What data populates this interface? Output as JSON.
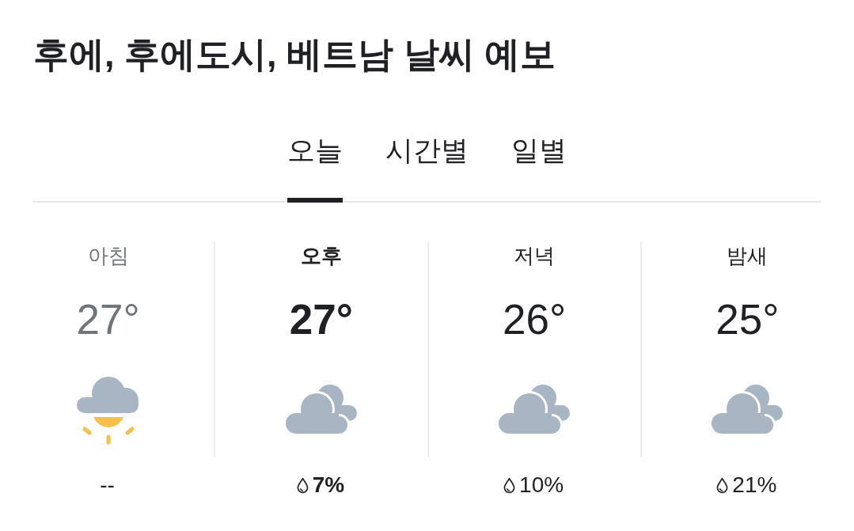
{
  "title": "후에, 후에도시, 베트남 날씨 예보",
  "tabs": [
    {
      "label": "오늘",
      "selected": true
    },
    {
      "label": "시간별",
      "selected": false
    },
    {
      "label": "일별",
      "selected": false
    }
  ],
  "periods": [
    {
      "name": "아침",
      "temperature": "27°",
      "kind": "sunrise",
      "precipitation": "--",
      "drop": false,
      "past": true,
      "current": false
    },
    {
      "name": "오후",
      "temperature": "27°",
      "kind": "cloudy",
      "precipitation": "7%",
      "drop": true,
      "past": false,
      "current": true
    },
    {
      "name": "저녁",
      "temperature": "26°",
      "kind": "cloudy",
      "precipitation": "10%",
      "drop": true,
      "past": false,
      "current": false
    },
    {
      "name": "밤새",
      "temperature": "25°",
      "kind": "cloudy",
      "precipitation": "21%",
      "drop": true,
      "past": false,
      "current": false
    }
  ]
}
